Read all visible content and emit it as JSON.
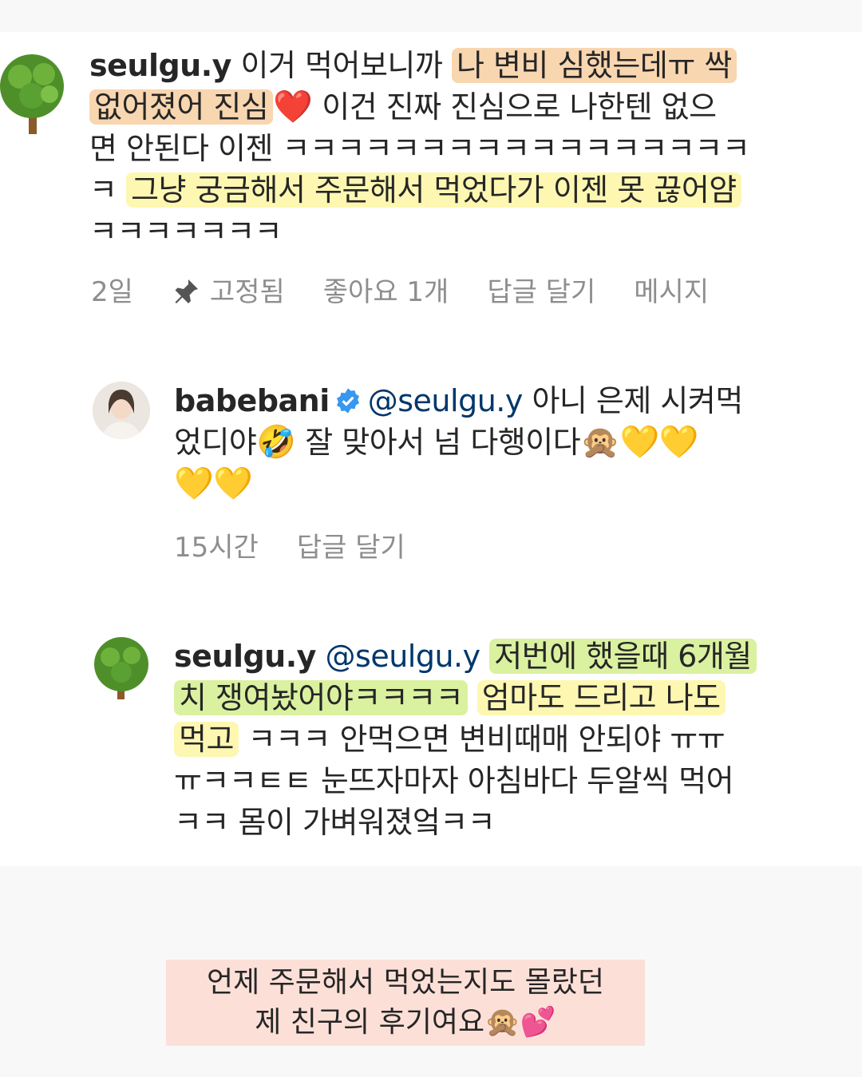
{
  "comment1": {
    "username": "seulgu.y",
    "avatar_icon": "tree-icon",
    "line1_text": "이거 먹어보니까",
    "line1_hl": "나 변비 심했는데ㅠ 싹",
    "line2_hl": "없어졌어 진심",
    "line2_emoji": "❤️",
    "line2_text": "이건 진짜 진심으로 나한텐 없으",
    "line3_text": "면 안된다 이젠 ㅋㅋㅋㅋㅋㅋㅋㅋㅋㅋㅋㅋㅋㅋㅋㅋㅋ",
    "line4_text": "ㅋ",
    "line4_hl": "그냥 궁금해서 주문해서 먹었다가 이젠 못 끊어얌",
    "line5_text": "ㅋㅋㅋㅋㅋㅋㅋ",
    "time": "2일",
    "pinned": "고정됨",
    "likes": "좋아요 1개",
    "reply": "답글 달기",
    "message": "메시지"
  },
  "comment2": {
    "username": "babebani",
    "verified_icon": "verified-badge-icon",
    "mention": "@seulgu.y",
    "line1_text": "아니 은제 시켜먹",
    "line2_text": "었디야",
    "line2_emoji1": "🤣",
    "line2_text2": "잘 맞아서 넘 다행이다",
    "line2_emoji2": "🙊💛💛",
    "line3_emoji": "💛💛",
    "time": "15시간",
    "reply": "답글 달기"
  },
  "comment3": {
    "username": "seulgu.y",
    "mention": "@seulgu.y",
    "line1_hl": "저번에 했을때 6개월",
    "line2_hl": "치 쟁여놨어야ㅋㅋㅋㅋ",
    "line2_hl2": "엄마도 드리고 나도",
    "line3_hl": "먹고",
    "line3_text": "ㅋㅋㅋ 안먹으면 변비때매 안되야 ㅠㅠ",
    "line4_text": "ㅠㅋㅋㅌㅌ 눈뜨자마자 아침바다 두알씩 먹어",
    "line5_text": "ㅋㅋ 몸이 가벼워졌엌ㅋㅋ"
  },
  "caption": {
    "line1": "언제 주문해서 먹었는지도 몰랐던",
    "line2": "제 친구의 후기여요",
    "emoji": "🙊💕"
  },
  "colors": {
    "highlight_orange": "#f5c896",
    "highlight_yellow": "#fdf6aa",
    "highlight_green": "#d6f096",
    "caption_bg": "#fcded6",
    "mention": "#00376b",
    "meta": "#8e8e8e"
  }
}
